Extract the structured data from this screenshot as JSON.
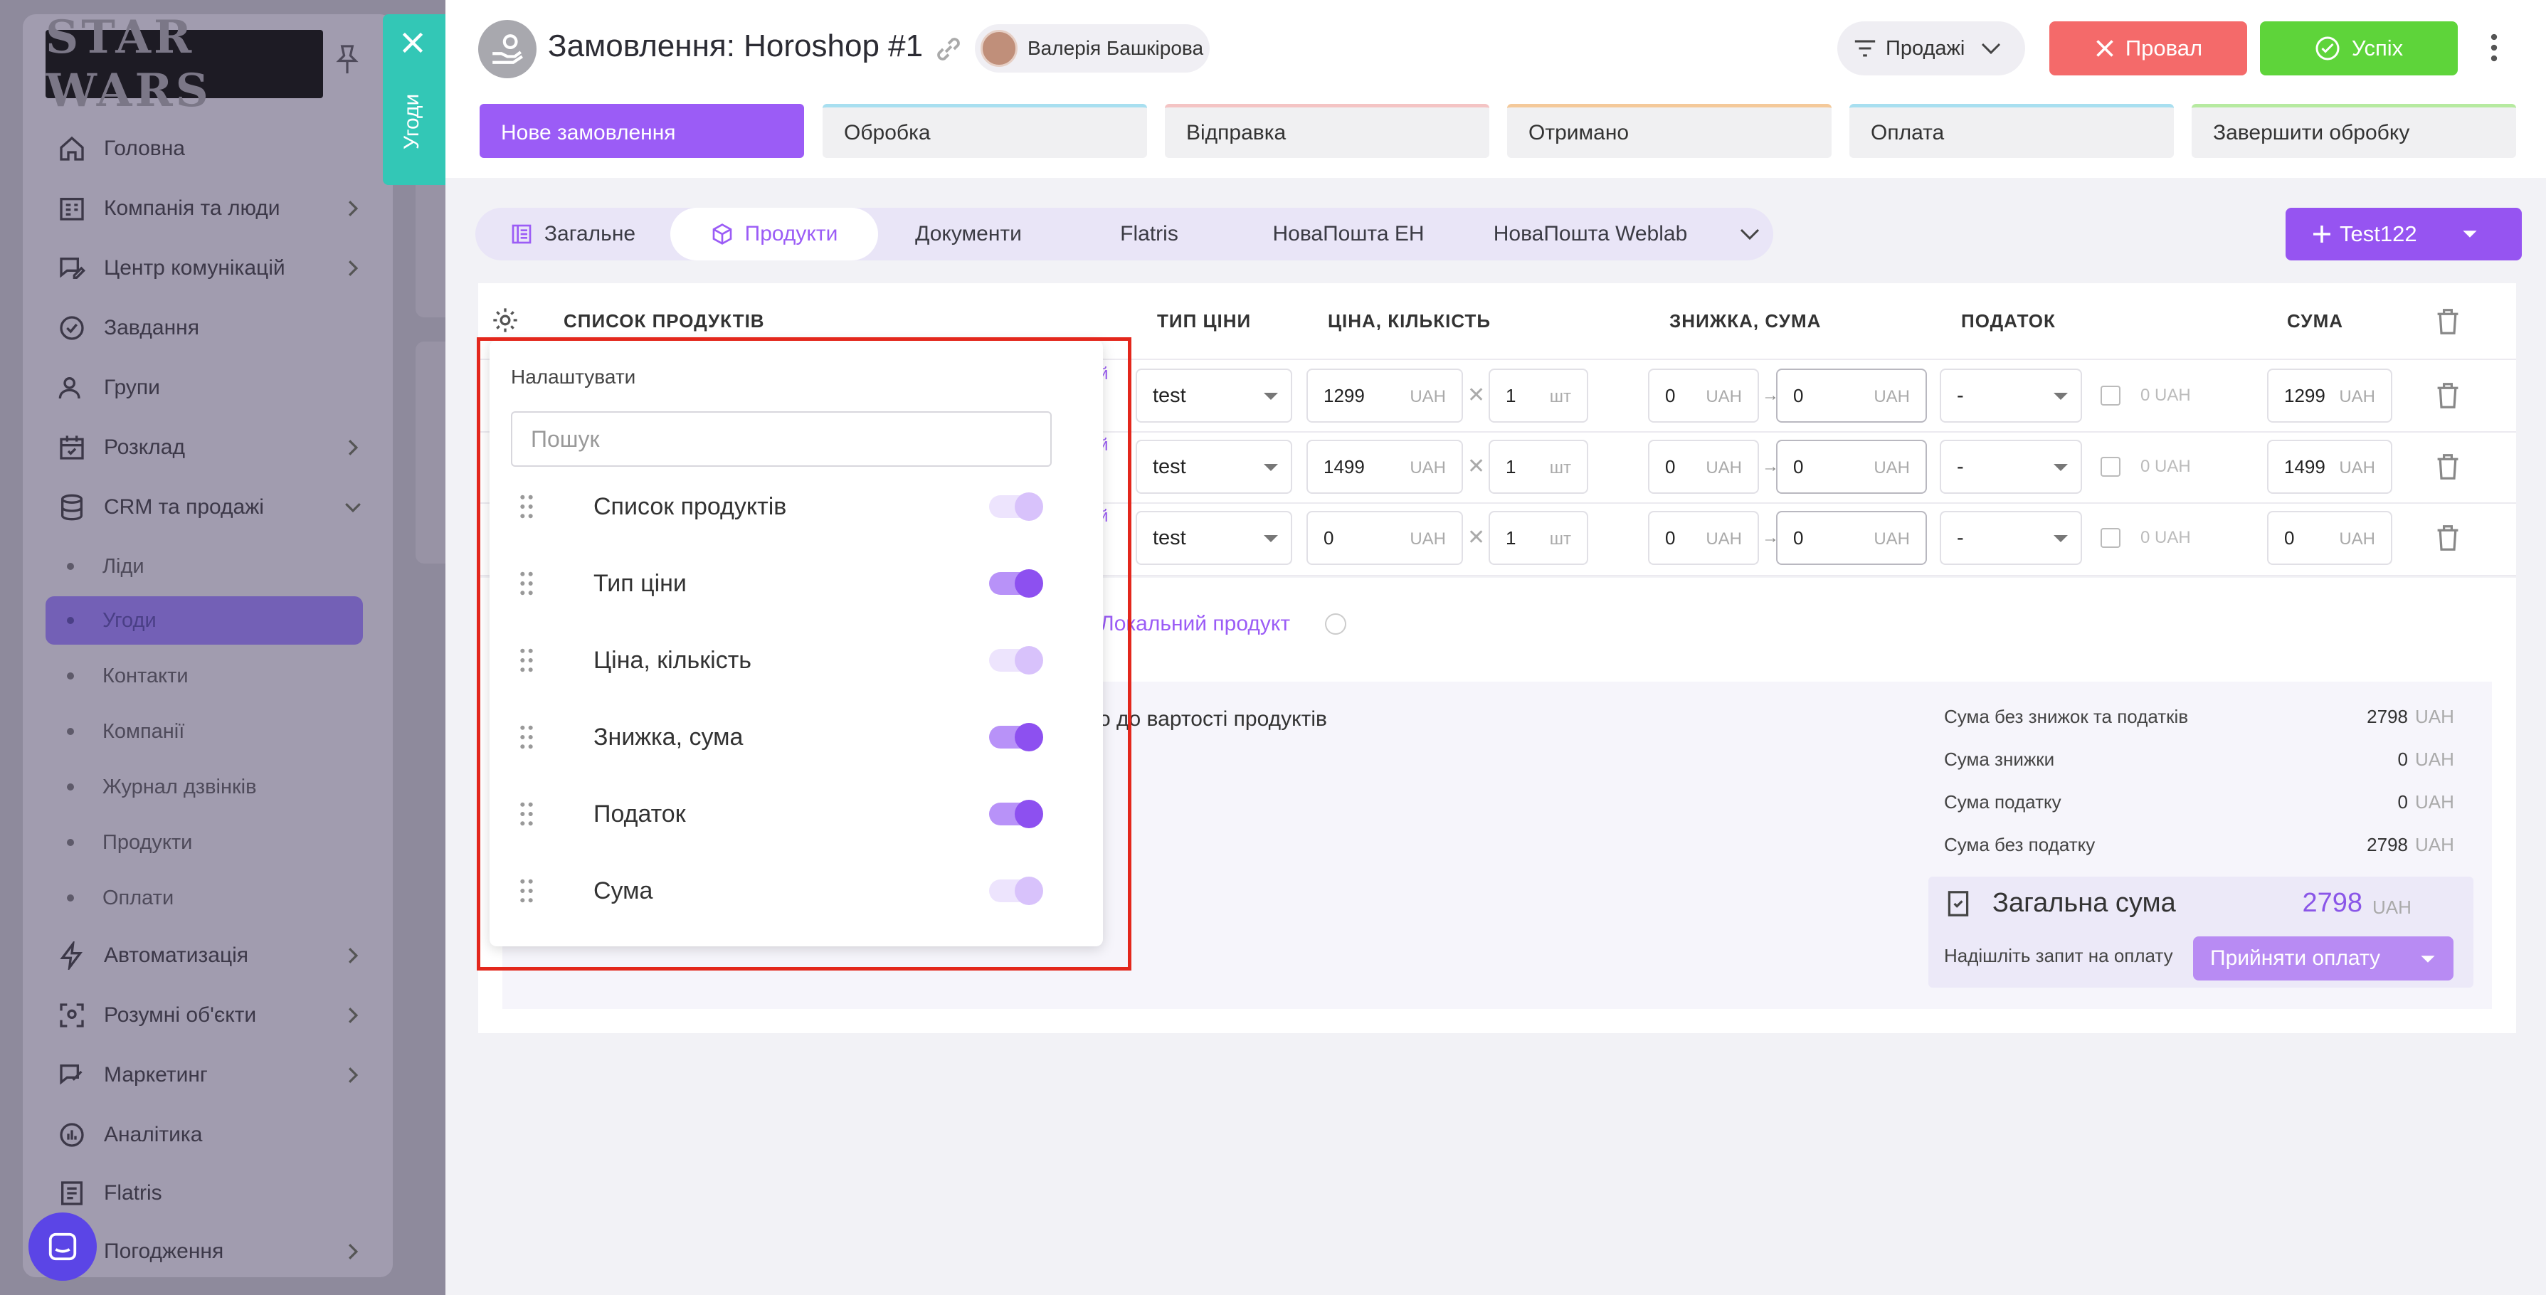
{
  "sidebar": {
    "logo_text": "STAR WARS",
    "items": [
      {
        "label": "Головна",
        "icon": "home-icon"
      },
      {
        "label": "Компанія та люди",
        "icon": "company-icon"
      },
      {
        "label": "Центр комунікацій",
        "icon": "chat-edit-icon"
      },
      {
        "label": "Завдання",
        "icon": "check-circle-icon"
      },
      {
        "label": "Групи",
        "icon": "users-icon"
      },
      {
        "label": "Розклад",
        "icon": "calendar-icon"
      },
      {
        "label": "CRM та продажі",
        "icon": "database-icon"
      },
      {
        "label": "Автоматизація",
        "icon": "bolt-icon"
      },
      {
        "label": "Розумні об'єкти",
        "icon": "smart-object-icon"
      },
      {
        "label": "Маркетинг",
        "icon": "marketing-icon"
      },
      {
        "label": "Аналітика",
        "icon": "analytics-icon"
      },
      {
        "label": "Flatris",
        "icon": "flatris-icon"
      },
      {
        "label": "Погодження",
        "icon": "approval-icon"
      }
    ],
    "sub_items": [
      "Ліди",
      "Угоди",
      "Контакти",
      "Компанії",
      "Журнал дзвінків",
      "Продукти",
      "Оплати"
    ]
  },
  "side_tab": {
    "label": "Угоди"
  },
  "header": {
    "title": "Замовлення: Horoshop #1",
    "user_name": "Валерія Башкірова",
    "pipeline": "Продажі",
    "fail_label": "Провал",
    "success_label": "Успіх"
  },
  "stages": [
    {
      "label": "Нове замовлення",
      "color": "#9b5cf6"
    },
    {
      "label": "Обробка",
      "color": "#a8dff0"
    },
    {
      "label": "Відправка",
      "color": "#f4c4c4"
    },
    {
      "label": "Отримано",
      "color": "#f4c99a"
    },
    {
      "label": "Оплата",
      "color": "#a8dff0"
    },
    {
      "label": "Завершити обробку",
      "color": "#b6eaa0"
    }
  ],
  "tabs": [
    "Загальне",
    "Продукти",
    "Документи",
    "Flatris",
    "НоваПошта ЕН",
    "НоваПошта Weblab"
  ],
  "add_button": "Test122",
  "table": {
    "headers": {
      "products": "СПИСОК ПРОДУКТІВ",
      "price_type": "ТИП ЦІНИ",
      "price_qty": "ЦІНА, КІЛЬКІСТЬ",
      "discount_sum": "ЗНИЖКА, СУМА",
      "tax": "ПОДАТОК",
      "sum": "СУМА"
    },
    "rows": [
      {
        "price_type": "test",
        "price": "1299",
        "currency": "UAH",
        "qty": "1",
        "qty_unit": "шт",
        "discount": "0",
        "discount_sum": "0",
        "tax": "-",
        "tax_value": "0 UAH",
        "total": "1299"
      },
      {
        "price_type": "test",
        "price": "1499",
        "currency": "UAH",
        "qty": "1",
        "qty_unit": "шт",
        "discount": "0",
        "discount_sum": "0",
        "tax": "-",
        "tax_value": "0 UAH",
        "total": "1499"
      },
      {
        "price_type": "test",
        "price": "0",
        "currency": "UAH",
        "qty": "1",
        "qty_unit": "шт",
        "discount": "0",
        "discount_sum": "0",
        "tax": "-",
        "tax_value": "0 UAH",
        "total": "0"
      }
    ],
    "partial_suffix": "й"
  },
  "local_product_link": "Локальний продукт",
  "discount_note": "о до вартості продуктів",
  "summary": {
    "rows": [
      {
        "label": "Сума без знижок та податків",
        "value": "2798",
        "currency": "UAH"
      },
      {
        "label": "Сума знижки",
        "value": "0",
        "currency": "UAH"
      },
      {
        "label": "Сума податку",
        "value": "0",
        "currency": "UAH"
      },
      {
        "label": "Сума без податку",
        "value": "2798",
        "currency": "UAH"
      }
    ],
    "total_label": "Загальна сума",
    "total_value": "2798",
    "total_currency": "UAH",
    "pay_request": "Надішліть запит на оплату",
    "pay_button": "Прийняти оплату"
  },
  "settings_popover": {
    "title": "Налаштувати",
    "search_placeholder": "Пошук",
    "columns": [
      {
        "label": "Список продуктів",
        "enabled": false
      },
      {
        "label": "Тип ціни",
        "enabled": true
      },
      {
        "label": "Ціна, кількість",
        "enabled": false
      },
      {
        "label": "Знижка, сума",
        "enabled": true
      },
      {
        "label": "Податок",
        "enabled": true
      },
      {
        "label": "Сума",
        "enabled": false
      }
    ]
  },
  "colors": {
    "accent": "#9b5cf6",
    "fail": "#f46a6a",
    "success": "#5ed43a",
    "teal": "#33c7b6",
    "highlight": "#e3271c"
  }
}
